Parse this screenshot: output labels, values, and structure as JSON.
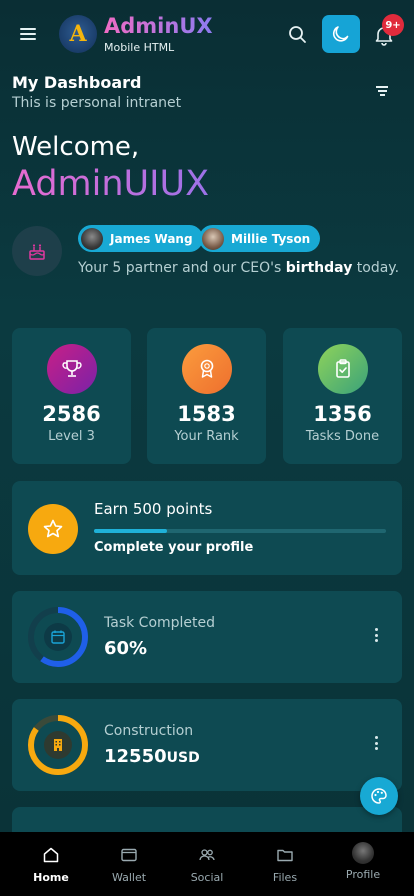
{
  "header": {
    "brand_title": "AdminUX",
    "brand_subtitle": "Mobile HTML",
    "logo_letter": "A",
    "notification_badge": "9+"
  },
  "dashboard": {
    "title": "My Dashboard",
    "subtitle": "This is personal intranet"
  },
  "welcome": {
    "greeting": "Welcome,",
    "name": "AdminUIUX"
  },
  "birthday": {
    "people": [
      "James Wang",
      "Millie Tyson"
    ],
    "text_prefix": "Your 5 partner and our CEO's ",
    "text_bold": "birthday",
    "text_suffix": " today."
  },
  "stats": [
    {
      "value": "2586",
      "label": "Level 3",
      "icon": "trophy-icon",
      "color": "#b61f8f"
    },
    {
      "value": "1583",
      "label": "Your Rank",
      "icon": "medal-icon",
      "color": "#f6863a"
    },
    {
      "value": "1356",
      "label": "Tasks Done",
      "icon": "clipboard-check-icon",
      "color": "#6fbf63"
    }
  ],
  "earn": {
    "title": "Earn 500 points",
    "subtitle": "Complete your profile",
    "progress": 0.25
  },
  "tasks": [
    {
      "label": "Task Completed",
      "value": "60%",
      "unit": "",
      "icon": "calendar-icon",
      "ring_color": "#1f5fe8",
      "progress": 0.6
    },
    {
      "label": "Construction",
      "value": "12550",
      "unit": "USD",
      "icon": "building-icon",
      "ring_color": "#f7a90f",
      "progress": 0.85
    }
  ],
  "nav": [
    {
      "label": "Home",
      "icon": "home-icon",
      "active": true
    },
    {
      "label": "Wallet",
      "icon": "wallet-icon",
      "active": false
    },
    {
      "label": "Social",
      "icon": "people-icon",
      "active": false
    },
    {
      "label": "Files",
      "icon": "folder-icon",
      "active": false
    },
    {
      "label": "Profile",
      "icon": "avatar-icon",
      "active": false
    }
  ],
  "colors": {
    "accent": "#18a9d4",
    "card": "#0e4a52",
    "background": "#0a2e34"
  }
}
